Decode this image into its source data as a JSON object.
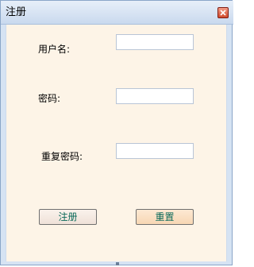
{
  "window": {
    "title": "注册",
    "close_icon": "close-icon"
  },
  "form": {
    "username_label": "用户名:",
    "username_value": "",
    "password_label": "密码:",
    "password_value": "",
    "confirm_password_label": "重复密码:",
    "confirm_password_value": ""
  },
  "buttons": {
    "register_label": "注册",
    "reset_label": "重置"
  },
  "colors": {
    "client_background": "#fdf4e7",
    "button_text": "#0c6a5a",
    "close_button": "#d04a2c"
  }
}
